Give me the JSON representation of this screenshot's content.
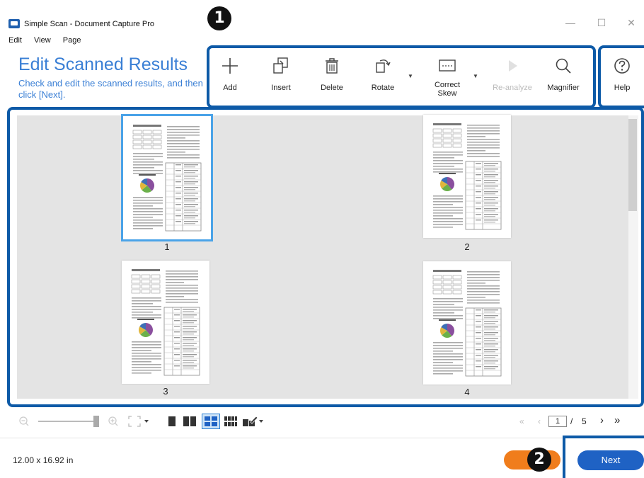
{
  "window": {
    "title": "Simple Scan - Document Capture Pro",
    "minimize": "—",
    "maximize": "☐",
    "close": "✕"
  },
  "menu": [
    "Edit",
    "View",
    "Page"
  ],
  "heading": {
    "title": "Edit Scanned Results",
    "subtitle": "Check and edit the scanned results, and then click [Next]."
  },
  "toolbar": {
    "add": "Add",
    "insert": "Insert",
    "delete": "Delete",
    "rotate": "Rotate",
    "correct_skew": "Correct Skew",
    "reanalyze": "Re-analyze",
    "magnifier": "Magnifier",
    "help": "Help"
  },
  "callouts": {
    "one": "1",
    "two": "2"
  },
  "pages": [
    {
      "number": "1",
      "selected": true
    },
    {
      "number": "2",
      "selected": false
    },
    {
      "number": "3",
      "selected": false
    },
    {
      "number": "4",
      "selected": false
    }
  ],
  "pager": {
    "current": "1",
    "separator": "/",
    "total": "5"
  },
  "status": {
    "size": "12.00 x 16.92 in"
  },
  "buttons": {
    "next": "Next"
  },
  "colors": {
    "accent_blue": "#3a7fd5",
    "frame_blue": "#0d5aa7",
    "next_blue": "#1f62c4",
    "back_orange": "#f07d1c"
  }
}
